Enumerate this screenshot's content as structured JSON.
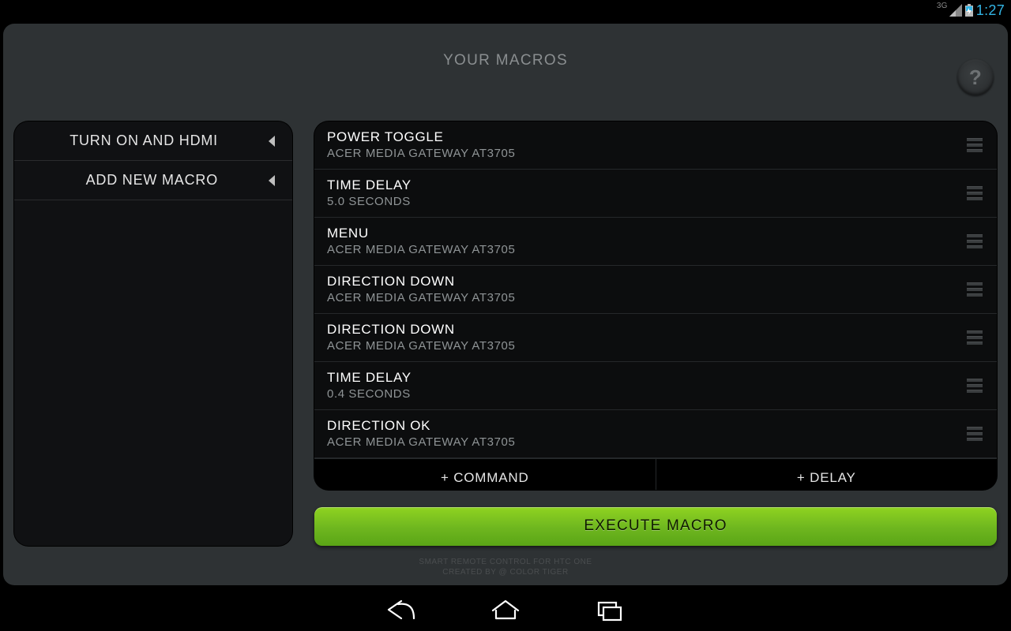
{
  "statusbar": {
    "network_label": "3G",
    "time": "1:27"
  },
  "header": {
    "title": "YOUR MACROS",
    "help_glyph": "?"
  },
  "sidebar": {
    "items": [
      {
        "label": "TURN ON AND HDMI"
      },
      {
        "label": "ADD NEW MACRO"
      }
    ]
  },
  "steps": [
    {
      "title": "POWER TOGGLE",
      "sub": "ACER MEDIA GATEWAY AT3705"
    },
    {
      "title": "TIME DELAY",
      "sub": "5.0 SECONDS"
    },
    {
      "title": "MENU",
      "sub": "ACER MEDIA GATEWAY AT3705"
    },
    {
      "title": "DIRECTION DOWN",
      "sub": "ACER MEDIA GATEWAY AT3705"
    },
    {
      "title": "DIRECTION DOWN",
      "sub": "ACER MEDIA GATEWAY AT3705"
    },
    {
      "title": "TIME DELAY",
      "sub": "0.4 SECONDS"
    },
    {
      "title": "DIRECTION OK",
      "sub": "ACER MEDIA GATEWAY AT3705"
    }
  ],
  "actions": {
    "add_command": "+ COMMAND",
    "add_delay": "+ DELAY",
    "execute": "EXECUTE MACRO"
  },
  "footer": {
    "line1": "SMART REMOTE CONTROL FOR HTC ONE",
    "line2": "CREATED BY @ COLOR TIGER"
  }
}
